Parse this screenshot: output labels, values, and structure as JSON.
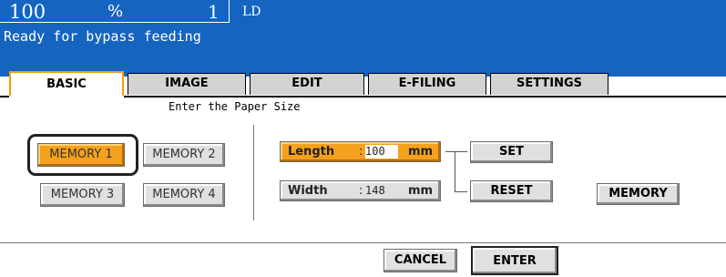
{
  "status": {
    "copies": "100",
    "percent": "%",
    "count": "1",
    "paper": "LD",
    "message": "Ready for bypass feeding"
  },
  "tabs": [
    {
      "label": "BASIC",
      "active": true
    },
    {
      "label": "IMAGE",
      "active": false
    },
    {
      "label": "EDIT",
      "active": false
    },
    {
      "label": "E-FILING",
      "active": false
    },
    {
      "label": "SETTINGS",
      "active": false
    }
  ],
  "instruction": "Enter the Paper Size",
  "memory_buttons": [
    "MEMORY 1",
    "MEMORY 2",
    "MEMORY 3",
    "MEMORY 4"
  ],
  "selected_memory": "MEMORY 1",
  "length": {
    "label": "Length",
    "colon": ":",
    "value": "100",
    "unit": "mm"
  },
  "width": {
    "label": "Width",
    "colon": ":",
    "value": "148",
    "unit": "mm"
  },
  "buttons": {
    "set": "SET",
    "reset": "RESET",
    "memory": "MEMORY",
    "cancel": "CANCEL",
    "enter": "ENTER"
  },
  "colors": {
    "status_bar": "#1565c0",
    "active_accent": "#f5a11d",
    "button_face": "#e0e0e0"
  }
}
